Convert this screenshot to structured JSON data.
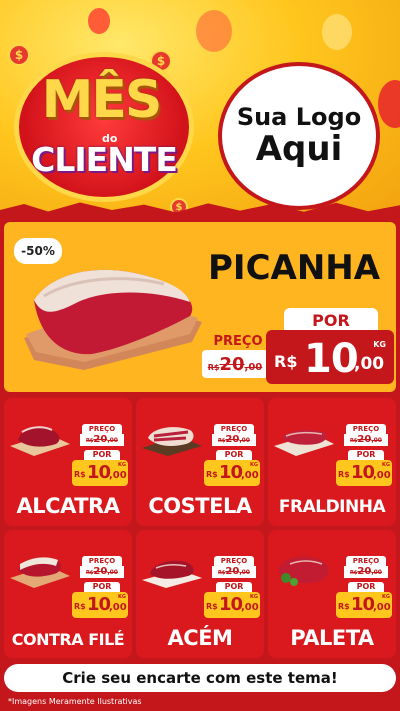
{
  "header": {
    "title_line1": "MÊS",
    "title_do": "do",
    "title_line2": "CLIENTE",
    "coin_symbol": "$",
    "logo_line1": "Sua Logo",
    "logo_line2": "Aqui"
  },
  "hero": {
    "discount": "-50%",
    "title": "PICANHA",
    "preco_label": "PREÇO",
    "old_currency": "R$",
    "old_int": "20",
    "old_dec": ",00",
    "por_label": "POR",
    "new_currency": "R$",
    "new_int": "10",
    "new_dec": ",00",
    "unit": "KG"
  },
  "cards": [
    {
      "name": "ALCATRA",
      "preco_label": "PREÇO",
      "old_currency": "R$",
      "old_int": "20",
      "old_dec": ",00",
      "por_label": "POR",
      "currency": "R$",
      "int": "10",
      "dec": ",00",
      "unit": "KG"
    },
    {
      "name": "COSTELA",
      "preco_label": "PREÇO",
      "old_currency": "R$",
      "old_int": "20",
      "old_dec": ",00",
      "por_label": "POR",
      "currency": "R$",
      "int": "10",
      "dec": ",00",
      "unit": "KG"
    },
    {
      "name": "FRALDINHA",
      "preco_label": "PREÇO",
      "old_currency": "R$",
      "old_int": "20",
      "old_dec": ",00",
      "por_label": "POR",
      "currency": "R$",
      "int": "10",
      "dec": ",00",
      "unit": "KG"
    },
    {
      "name": "CONTRA FILÉ",
      "preco_label": "PREÇO",
      "old_currency": "R$",
      "old_int": "20",
      "old_dec": ",00",
      "por_label": "POR",
      "currency": "R$",
      "int": "10",
      "dec": ",00",
      "unit": "KG"
    },
    {
      "name": "ACÉM",
      "preco_label": "PREÇO",
      "old_currency": "R$",
      "old_int": "20",
      "old_dec": ",00",
      "por_label": "POR",
      "currency": "R$",
      "int": "10",
      "dec": ",00",
      "unit": "KG"
    },
    {
      "name": "PALETA",
      "preco_label": "PREÇO",
      "old_currency": "R$",
      "old_int": "20",
      "old_dec": ",00",
      "por_label": "POR",
      "currency": "R$",
      "int": "10",
      "dec": ",00",
      "unit": "KG"
    }
  ],
  "cta": "Crie seu encarte com este tema!",
  "footnote": "*Imagens Meramente Ilustrativas",
  "colors": {
    "red": "#c3171b",
    "card_red": "#d9191e",
    "yellow": "#ffc61e",
    "orange": "#ffb520"
  }
}
